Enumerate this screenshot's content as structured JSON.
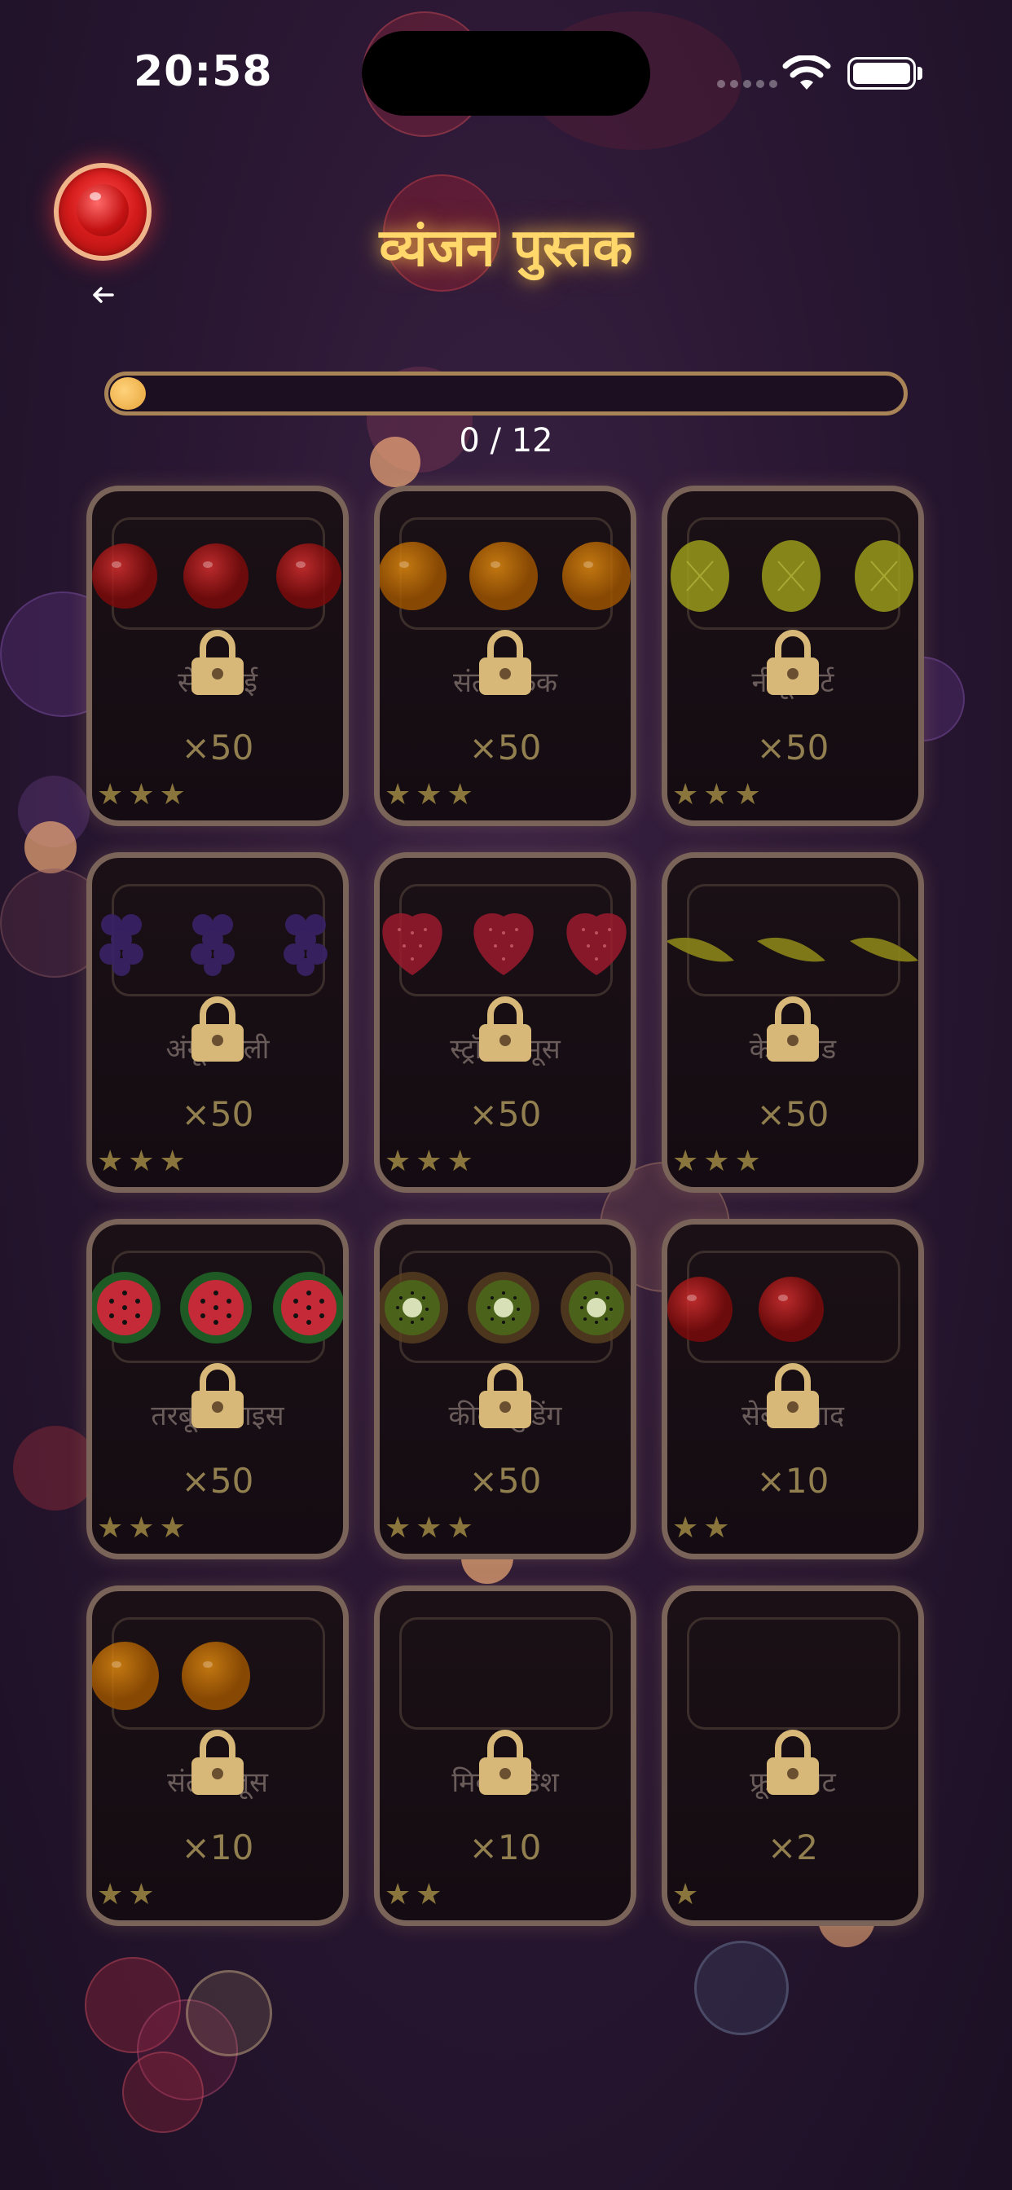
{
  "status_bar": {
    "time": "20:58"
  },
  "header": {
    "title": "व्यंजन पुस्तक"
  },
  "progress": {
    "text": "0 / 12",
    "fraction": 0
  },
  "colors": {
    "title": "#ffd76a",
    "card_border": "#7a6358",
    "accent": "#e6a33a"
  },
  "recipes": [
    {
      "name": "सेब पाई",
      "count": "×50",
      "stars": "★★★",
      "fruit": "apple",
      "fruit_count": 3
    },
    {
      "name": "संतरा केक",
      "count": "×50",
      "stars": "★★★",
      "fruit": "orange",
      "fruit_count": 3
    },
    {
      "name": "नींबू टार्ट",
      "count": "×50",
      "stars": "★★★",
      "fruit": "lemon",
      "fruit_count": 3
    },
    {
      "name": "अंगूर जेली",
      "count": "×50",
      "stars": "★★★",
      "fruit": "grape",
      "fruit_count": 3
    },
    {
      "name": "स्ट्रॉबेरी मूस",
      "count": "×50",
      "stars": "★★★",
      "fruit": "strawberry",
      "fruit_count": 3
    },
    {
      "name": "केला ब्रेड",
      "count": "×50",
      "stars": "★★★",
      "fruit": "banana",
      "fruit_count": 3
    },
    {
      "name": "तरबूज आइस",
      "count": "×50",
      "stars": "★★★",
      "fruit": "watermelon",
      "fruit_count": 3
    },
    {
      "name": "कीवी पुडिंग",
      "count": "×50",
      "stars": "★★★",
      "fruit": "kiwi",
      "fruit_count": 3
    },
    {
      "name": "सेब सलाद",
      "count": "×10",
      "stars": "★★",
      "fruit": "apple",
      "fruit_count": 2
    },
    {
      "name": "संतरा जूस",
      "count": "×10",
      "stars": "★★",
      "fruit": "orange",
      "fruit_count": 2
    },
    {
      "name": "मिक्स डिश",
      "count": "×10",
      "stars": "★★",
      "fruit": "none",
      "fruit_count": 0
    },
    {
      "name": "फ्रूट प्लेट",
      "count": "×2",
      "stars": "★",
      "fruit": "none",
      "fruit_count": 0
    }
  ]
}
